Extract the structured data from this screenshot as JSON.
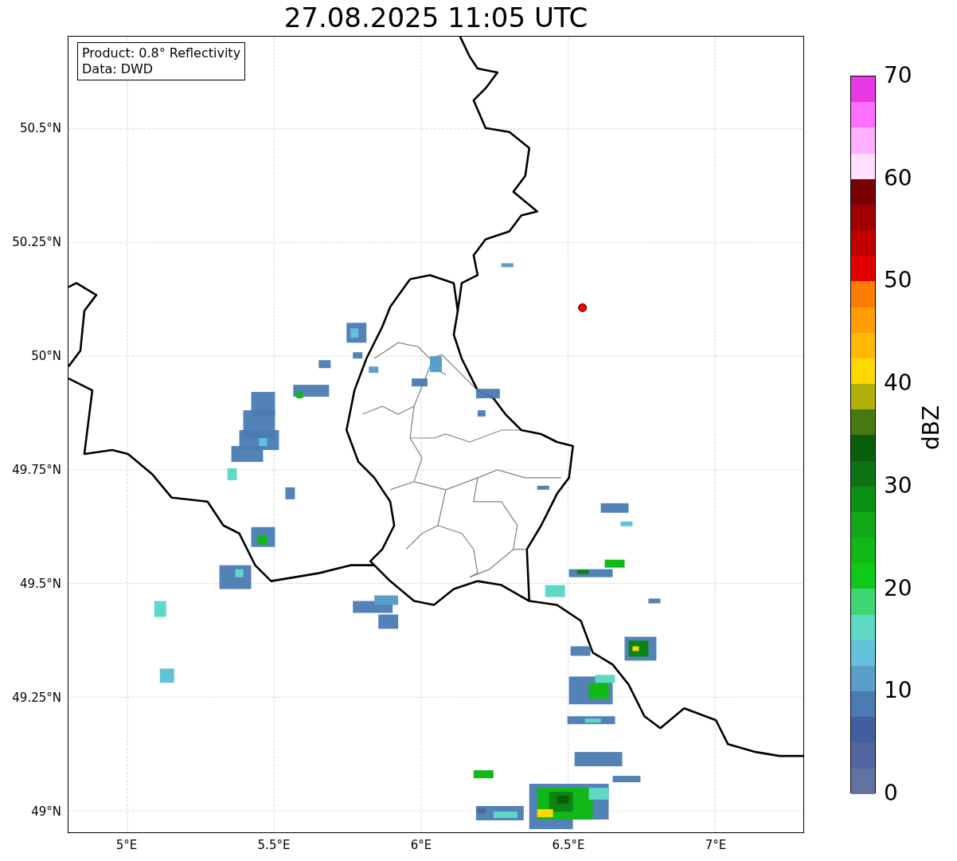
{
  "title": "27.08.2025 11:05 UTC",
  "info_box": {
    "lines": [
      "Product: 0.8° Reflectivity",
      "Data: DWD"
    ]
  },
  "map": {
    "latitude_labels": [
      "50.5°N",
      "50.25°N",
      "50°N",
      "49.75°N",
      "49.5°N",
      "49.25°N",
      "49°N"
    ],
    "longitude_labels": [
      "5°E",
      "5.5°E",
      "6°E",
      "6.5°E",
      "7°E"
    ]
  },
  "colorbar": {
    "label": "dBZ",
    "ticks": [
      "70",
      "60",
      "50",
      "40",
      "30",
      "20",
      "10",
      "0"
    ],
    "segments": [
      {
        "color": "#e838e8"
      },
      {
        "color": "#ff70ff"
      },
      {
        "color": "#ffb0ff"
      },
      {
        "color": "#ffe0ff"
      },
      {
        "color": "#780000"
      },
      {
        "color": "#a00000"
      },
      {
        "color": "#c00000"
      },
      {
        "color": "#e00000"
      },
      {
        "color": "#ff7c00"
      },
      {
        "color": "#ff9c00"
      },
      {
        "color": "#ffb800"
      },
      {
        "color": "#ffd800"
      },
      {
        "color": "#b0b008"
      },
      {
        "color": "#487810"
      },
      {
        "color": "#0a5e0a"
      },
      {
        "color": "#0c7414"
      },
      {
        "color": "#0b9014"
      },
      {
        "color": "#10a818"
      },
      {
        "color": "#10b818"
      },
      {
        "color": "#10c818"
      },
      {
        "color": "#3ed672"
      },
      {
        "color": "#60d8c6"
      },
      {
        "color": "#63c1dc"
      },
      {
        "color": "#5b9ec8"
      },
      {
        "color": "#4a7bb3"
      },
      {
        "color": "#435ea0"
      },
      {
        "color": "#52659f"
      },
      {
        "color": "#6272a4"
      }
    ]
  }
}
